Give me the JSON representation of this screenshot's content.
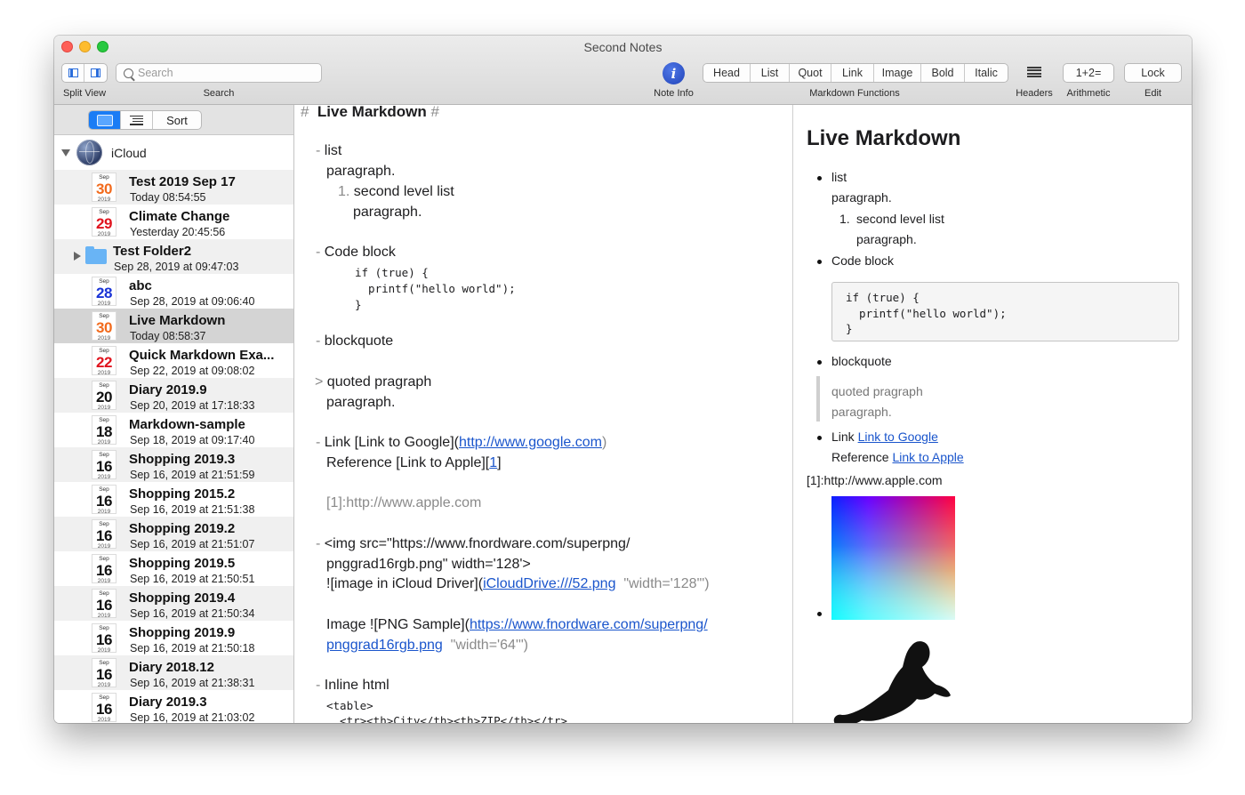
{
  "window": {
    "title": "Second Notes"
  },
  "toolbar": {
    "split_view_label": "Split View",
    "search_label": "Search",
    "search_placeholder": "Search",
    "note_info_label": "Note Info",
    "note_info_glyph": "i",
    "markdown_functions_label": "Markdown Functions",
    "markdown_buttons": [
      "Head",
      "List",
      "Quot",
      "Link",
      "Image",
      "Bold",
      "Italic"
    ],
    "headers_label": "Headers",
    "arithmetic_button": "1+2=",
    "arithmetic_label": "Arithmetic",
    "lock_button": "Lock",
    "edit_label": "Edit"
  },
  "sidebar": {
    "sort_label": "Sort",
    "root_label": "iCloud",
    "items": [
      {
        "kind": "note",
        "month": "Sep",
        "day": "30",
        "year": "2019",
        "day_color": "#f26b1d",
        "title": "Test 2019 Sep 17",
        "date": "Today 08:54:55"
      },
      {
        "kind": "note",
        "month": "Sep",
        "day": "29",
        "year": "2019",
        "day_color": "#e0141e",
        "title": "Climate Change",
        "date": "Yesterday 20:45:56"
      },
      {
        "kind": "folder",
        "title": "Test Folder2",
        "date": "Sep 28, 2019 at 09:47:03"
      },
      {
        "kind": "note",
        "month": "Sep",
        "day": "28",
        "year": "2019",
        "day_color": "#1a34d6",
        "title": "abc",
        "date": "Sep 28, 2019 at 09:06:40"
      },
      {
        "kind": "note",
        "month": "Sep",
        "day": "30",
        "year": "2019",
        "day_color": "#f26b1d",
        "title": "Live Markdown",
        "date": "Today 08:58:37",
        "selected": true
      },
      {
        "kind": "note",
        "month": "Sep",
        "day": "22",
        "year": "2019",
        "day_color": "#e0141e",
        "title": "Quick Markdown Exa...",
        "date": "Sep 22, 2019 at 09:08:02"
      },
      {
        "kind": "note",
        "month": "Sep",
        "day": "20",
        "year": "2019",
        "day_color": "#111111",
        "title": "Diary 2019.9",
        "date": "Sep 20, 2019 at 17:18:33"
      },
      {
        "kind": "note",
        "month": "Sep",
        "day": "18",
        "year": "2019",
        "day_color": "#111111",
        "title": "Markdown-sample",
        "date": "Sep 18, 2019 at 09:17:40"
      },
      {
        "kind": "note",
        "month": "Sep",
        "day": "16",
        "year": "2019",
        "day_color": "#111111",
        "title": "Shopping 2019.3",
        "date": "Sep 16, 2019 at 21:51:59"
      },
      {
        "kind": "note",
        "month": "Sep",
        "day": "16",
        "year": "2019",
        "day_color": "#111111",
        "title": "Shopping 2015.2",
        "date": "Sep 16, 2019 at 21:51:38"
      },
      {
        "kind": "note",
        "month": "Sep",
        "day": "16",
        "year": "2019",
        "day_color": "#111111",
        "title": "Shopping 2019.2",
        "date": "Sep 16, 2019 at 21:51:07"
      },
      {
        "kind": "note",
        "month": "Sep",
        "day": "16",
        "year": "2019",
        "day_color": "#111111",
        "title": "Shopping 2019.5",
        "date": "Sep 16, 2019 at 21:50:51"
      },
      {
        "kind": "note",
        "month": "Sep",
        "day": "16",
        "year": "2019",
        "day_color": "#111111",
        "title": "Shopping 2019.4",
        "date": "Sep 16, 2019 at 21:50:34"
      },
      {
        "kind": "note",
        "month": "Sep",
        "day": "16",
        "year": "2019",
        "day_color": "#111111",
        "title": "Shopping 2019.9",
        "date": "Sep 16, 2019 at 21:50:18"
      },
      {
        "kind": "note",
        "month": "Sep",
        "day": "16",
        "year": "2019",
        "day_color": "#111111",
        "title": "Diary 2018.12",
        "date": "Sep 16, 2019 at 21:38:31"
      },
      {
        "kind": "note",
        "month": "Sep",
        "day": "16",
        "year": "2019",
        "day_color": "#111111",
        "title": "Diary 2019.3",
        "date": "Sep 16, 2019 at 21:03:02"
      }
    ]
  },
  "editor": {
    "heading_mark": "#",
    "heading_text": "Live Markdown",
    "heading_mark_end": "#",
    "list_mark": "-",
    "list_item": "list",
    "list_para": "paragraph.",
    "sublist_num": "1.",
    "sublist_item": "second level list",
    "sublist_para": "paragraph.",
    "codeblock_item": "Code block",
    "code_line1": "if (true) {",
    "code_line2": "  printf(\"hello world\");",
    "code_line3": "}",
    "blockquote_item": "blockquote",
    "quote_mark": ">",
    "quote_line1": "quoted pragraph",
    "quote_line2": "paragraph.",
    "link_prefix": "Link [Link to Google](",
    "link_url": "http://www.google.com",
    "link_suffix": ")",
    "ref_prefix": "Reference [Link to Apple][",
    "ref_num": "1",
    "ref_suffix": "]",
    "ref_def": "[1]:http://www.apple.com",
    "img_line1": "<img src=\"https://www.fnordware.com/superpng/",
    "img_line2": "pnggrad16rgb.png\"  width='128'>",
    "img_line3_prefix": "![image in iCloud Driver](",
    "img_line3_url": "iCloudDrive:///52.png",
    "img_line3_suffix": "\"width='128'\")",
    "img2_prefix": "Image ![PNG Sample](",
    "img2_url1": "https://www.fnordware.com/superpng/",
    "img2_url2": "pnggrad16rgb.png",
    "img2_suffix": "\"width='64'\")",
    "inline_html_item": "Inline html",
    "html_line1": "<table>",
    "html_line2": "  <tr><th>City</th><th>ZIP</th></tr>"
  },
  "preview": {
    "h1": "Live Markdown",
    "list_item": "list",
    "list_para": "paragraph.",
    "sublist_num": "1.",
    "sublist_item": "second level list",
    "sublist_para": "paragraph.",
    "codeblock_item": "Code block",
    "code": "if (true) {\n  printf(\"hello world\");\n}",
    "blockquote_item": "blockquote",
    "quote_line1": "quoted pragraph",
    "quote_line2": "paragraph.",
    "link_prefix": "Link",
    "link_text": "Link to Google",
    "ref_prefix": "Reference",
    "ref_text": "Link to Apple",
    "ref_def": "[1]:http://www.apple.com"
  }
}
